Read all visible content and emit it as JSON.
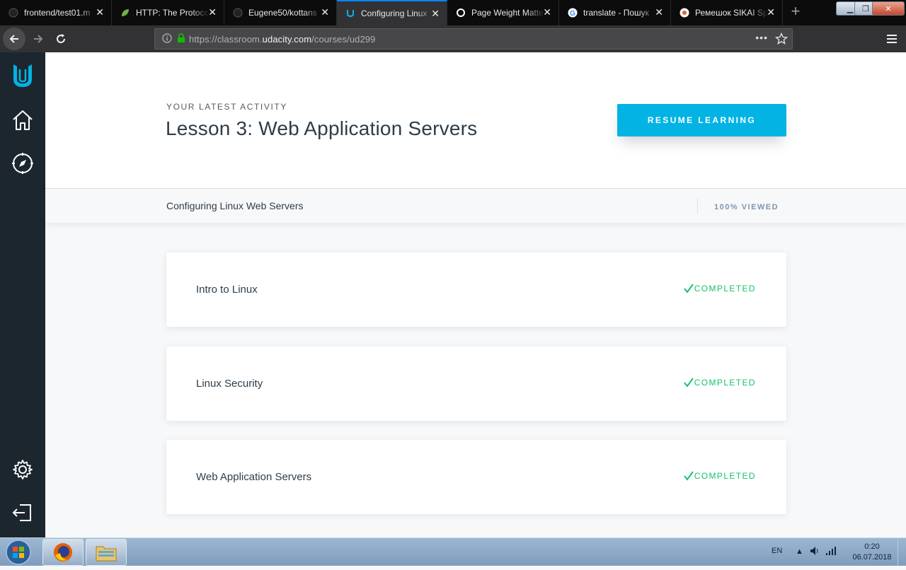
{
  "browser": {
    "tabs": [
      {
        "title": "frontend/test01.m",
        "favicon": "github-icon"
      },
      {
        "title": "HTTP: The Protoco",
        "favicon": "leaf-icon"
      },
      {
        "title": "Eugene50/kottans",
        "favicon": "github-icon"
      },
      {
        "title": "Configuring Linux",
        "favicon": "udacity-icon",
        "active": true
      },
      {
        "title": "Page Weight Matte",
        "favicon": "circle-icon"
      },
      {
        "title": "translate - Пошук",
        "favicon": "google-icon"
      },
      {
        "title": "Ремешок SIKAI Sp",
        "favicon": "olx-icon"
      }
    ],
    "new_tab": "+",
    "url_prefix": "https://classroom.",
    "url_domain": "udacity.com",
    "url_path": "/courses/ud299",
    "page_actions": "•••"
  },
  "hero": {
    "eyebrow": "YOUR LATEST ACTIVITY",
    "lesson_title": "Lesson 3: Web Application Servers",
    "resume_label": "RESUME LEARNING"
  },
  "progress": {
    "course_name": "Configuring Linux Web Servers",
    "viewed_label": "100% VIEWED"
  },
  "lessons": [
    {
      "title": "Intro to Linux",
      "status": "COMPLETED"
    },
    {
      "title": "Linux Security",
      "status": "COMPLETED"
    },
    {
      "title": "Web Application Servers",
      "status": "COMPLETED"
    }
  ],
  "colors": {
    "accent": "#02b3e4",
    "completed": "#15c26b",
    "sidebar": "#1c262f"
  },
  "taskbar": {
    "lang": "EN",
    "time": "0:20",
    "date": "06.07.2018"
  }
}
